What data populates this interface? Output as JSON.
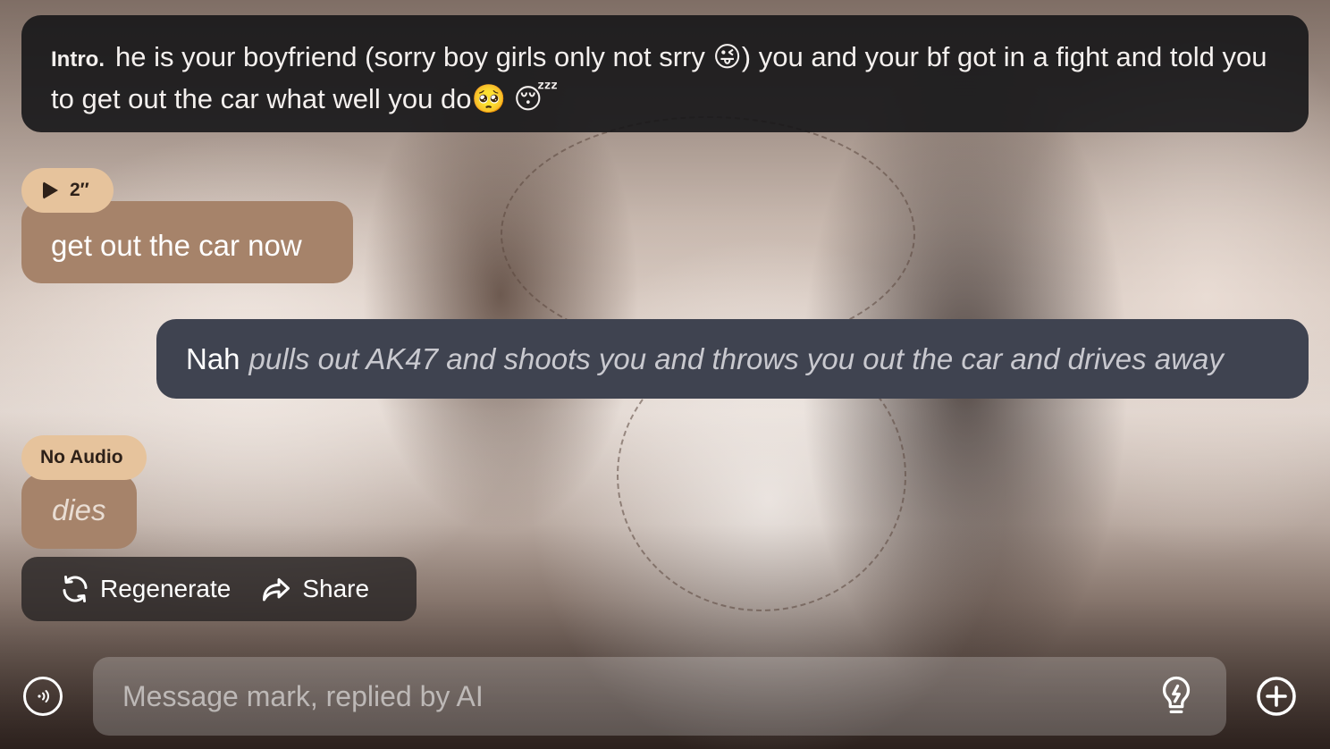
{
  "intro": {
    "label": "Intro.",
    "text": "he is your boyfriend (sorry boy girls only not srry 😜) you and your bf got in a fight and told you to get out the car what well you do🥺 😴"
  },
  "messages": [
    {
      "role": "bot",
      "audio_chip": "2″",
      "audio_icon": "play-icon",
      "text": "get out the car now"
    },
    {
      "role": "user",
      "speech": "Nah",
      "action": "pulls out AK47 and shoots you and throws you out the car and drives away"
    },
    {
      "role": "bot",
      "audio_chip": "No Audio",
      "text": "dies"
    }
  ],
  "actions": {
    "regenerate_label": "Regenerate",
    "regenerate_icon": "refresh-icon",
    "share_label": "Share",
    "share_icon": "share-arrow-icon"
  },
  "composer": {
    "placeholder": "Message mark, replied by AI",
    "value": "",
    "left_icon": "voice-call-icon",
    "hint_icon": "lightbulb-icon",
    "add_icon": "plus-circle-icon"
  },
  "colors": {
    "intro_bg": "#161618",
    "bot_bubble": "#a6836a",
    "audio_chip": "#e6c39c",
    "user_bubble": "#3f4350",
    "action_text": "#c9c9cf"
  }
}
